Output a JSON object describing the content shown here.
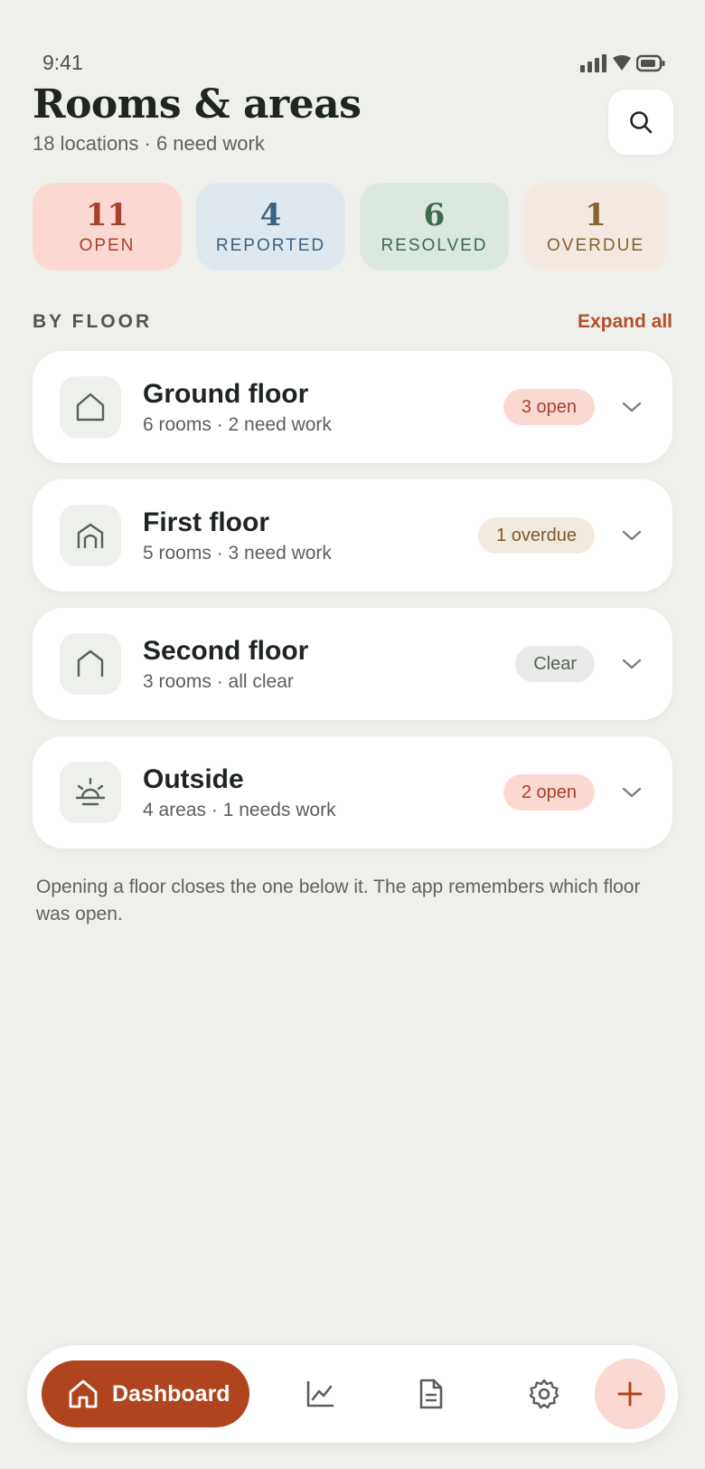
{
  "status_bar": {
    "time": "9:41"
  },
  "header": {
    "title": "Rooms & areas",
    "subtitle": "18 locations · 6 need work",
    "search_icon": "search-icon"
  },
  "stats": [
    {
      "value": "11",
      "label": "OPEN",
      "color": "#a5412c"
    },
    {
      "value": "4",
      "label": "REPORTED",
      "color": "#3c6280"
    },
    {
      "value": "6",
      "label": "RESOLVED",
      "color": "#3d6b4d"
    },
    {
      "value": "1",
      "label": "OVERDUE",
      "color": "#85622f"
    }
  ],
  "section": {
    "label": "BY FLOOR",
    "expand_label": "Expand all"
  },
  "floors": [
    {
      "name": "Ground floor",
      "meta": "6 rooms · 2 need work",
      "badge": "3 open",
      "badge_type": "open",
      "icon": "house-icon"
    },
    {
      "name": "First floor",
      "meta": "5 rooms · 3 need work",
      "badge": "1 overdue",
      "badge_type": "overdue",
      "icon": "arch-icon"
    },
    {
      "name": "Second floor",
      "meta": "3 rooms · all clear",
      "badge": "Clear",
      "badge_type": "clear",
      "icon": "roof-icon"
    },
    {
      "name": "Outside",
      "meta": "4 areas · 1 needs work",
      "badge": "2 open",
      "badge_type": "open",
      "icon": "sun-icon"
    }
  ],
  "footnote": "Opening a floor closes the one below it. The app remembers which floor was open.",
  "bottom_nav": {
    "active_label": "Dashboard",
    "items": [
      "chart-icon",
      "document-icon",
      "gear-icon"
    ],
    "fab_icon": "plus-icon"
  },
  "colors": {
    "accent": "#b0441f",
    "background": "#eff0ec"
  }
}
